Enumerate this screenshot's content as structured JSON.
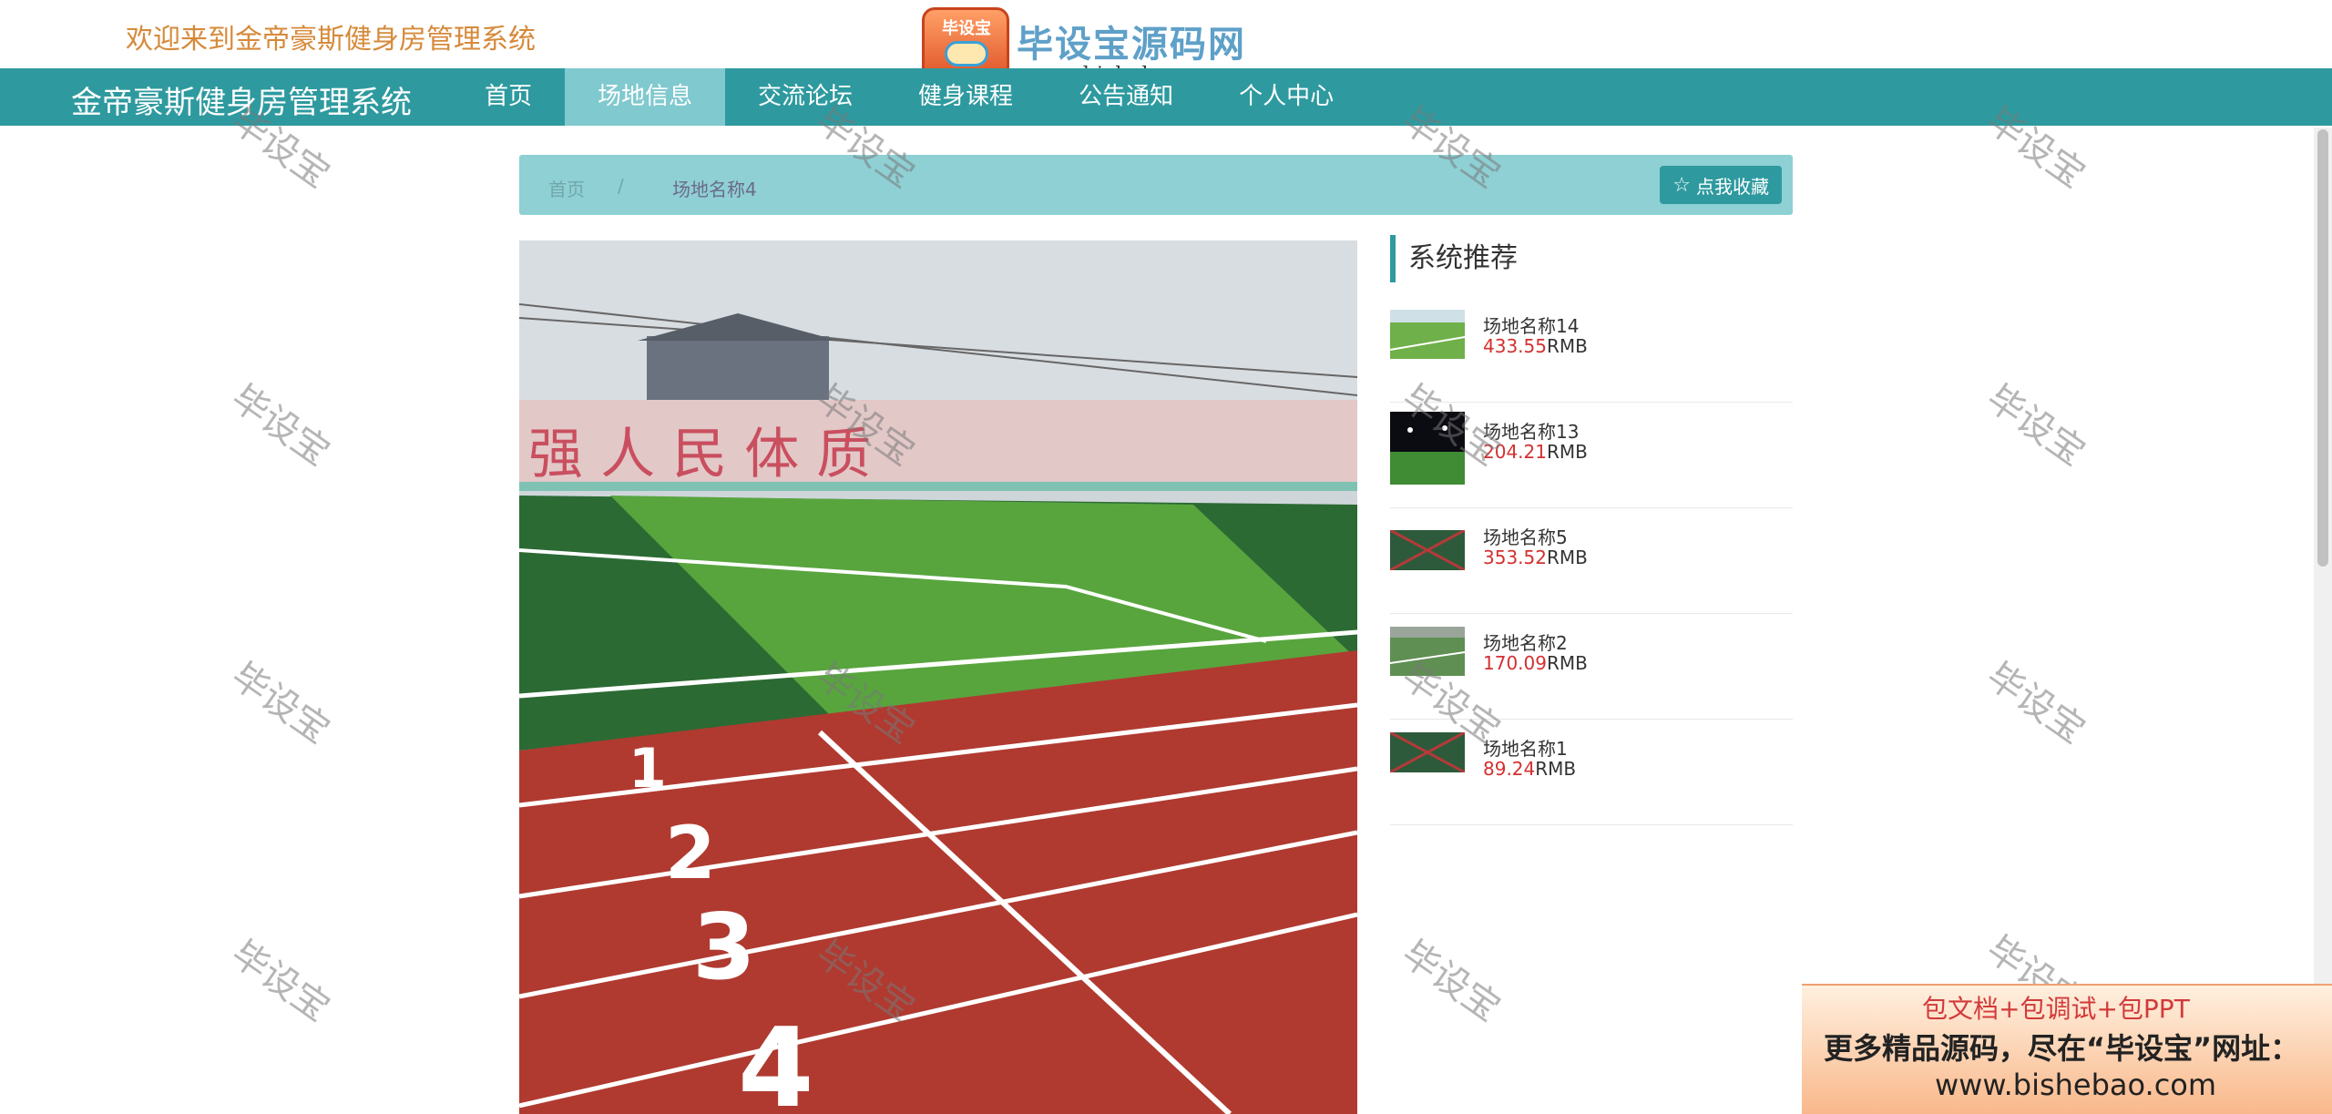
{
  "header": {
    "welcome": "欢迎来到金帝豪斯健身房管理系统",
    "logo_badge": "毕设宝",
    "logo_title": "毕设宝源码网",
    "logo_url": "www.bishebao.com"
  },
  "nav": {
    "brand": "金帝豪斯健身房管理系统",
    "items": [
      {
        "label": "首页"
      },
      {
        "label": "场地信息"
      },
      {
        "label": "交流论坛"
      },
      {
        "label": "健身课程"
      },
      {
        "label": "公告通知"
      },
      {
        "label": "个人中心"
      }
    ],
    "active_index": 1
  },
  "watermark": "毕设宝",
  "breadcrumb": {
    "home": "首页",
    "separator": "/",
    "current": "场地名称4"
  },
  "favorite_button": {
    "icon": "star-outline-icon",
    "label": "点我收藏"
  },
  "recommend": {
    "title": "系统推荐",
    "currency": "RMB",
    "items": [
      {
        "name": "场地名称14",
        "price": "433.55"
      },
      {
        "name": "场地名称13",
        "price": "204.21"
      },
      {
        "name": "场地名称5",
        "price": "353.52"
      },
      {
        "name": "场地名称2",
        "price": "170.09"
      },
      {
        "name": "场地名称1",
        "price": "89.24"
      }
    ]
  },
  "ad": {
    "line1": "包文档+包调试+包PPT",
    "line2": "更多精品源码，尽在“毕设宝”网址：",
    "line3": "www.bishebao.com"
  },
  "colors": {
    "primary": "#2e9a9f",
    "nav_active": "#80c9cf",
    "breadcrumb_bg": "#8fd0d4",
    "price": "#d43030",
    "welcome": "#d68a3a"
  }
}
